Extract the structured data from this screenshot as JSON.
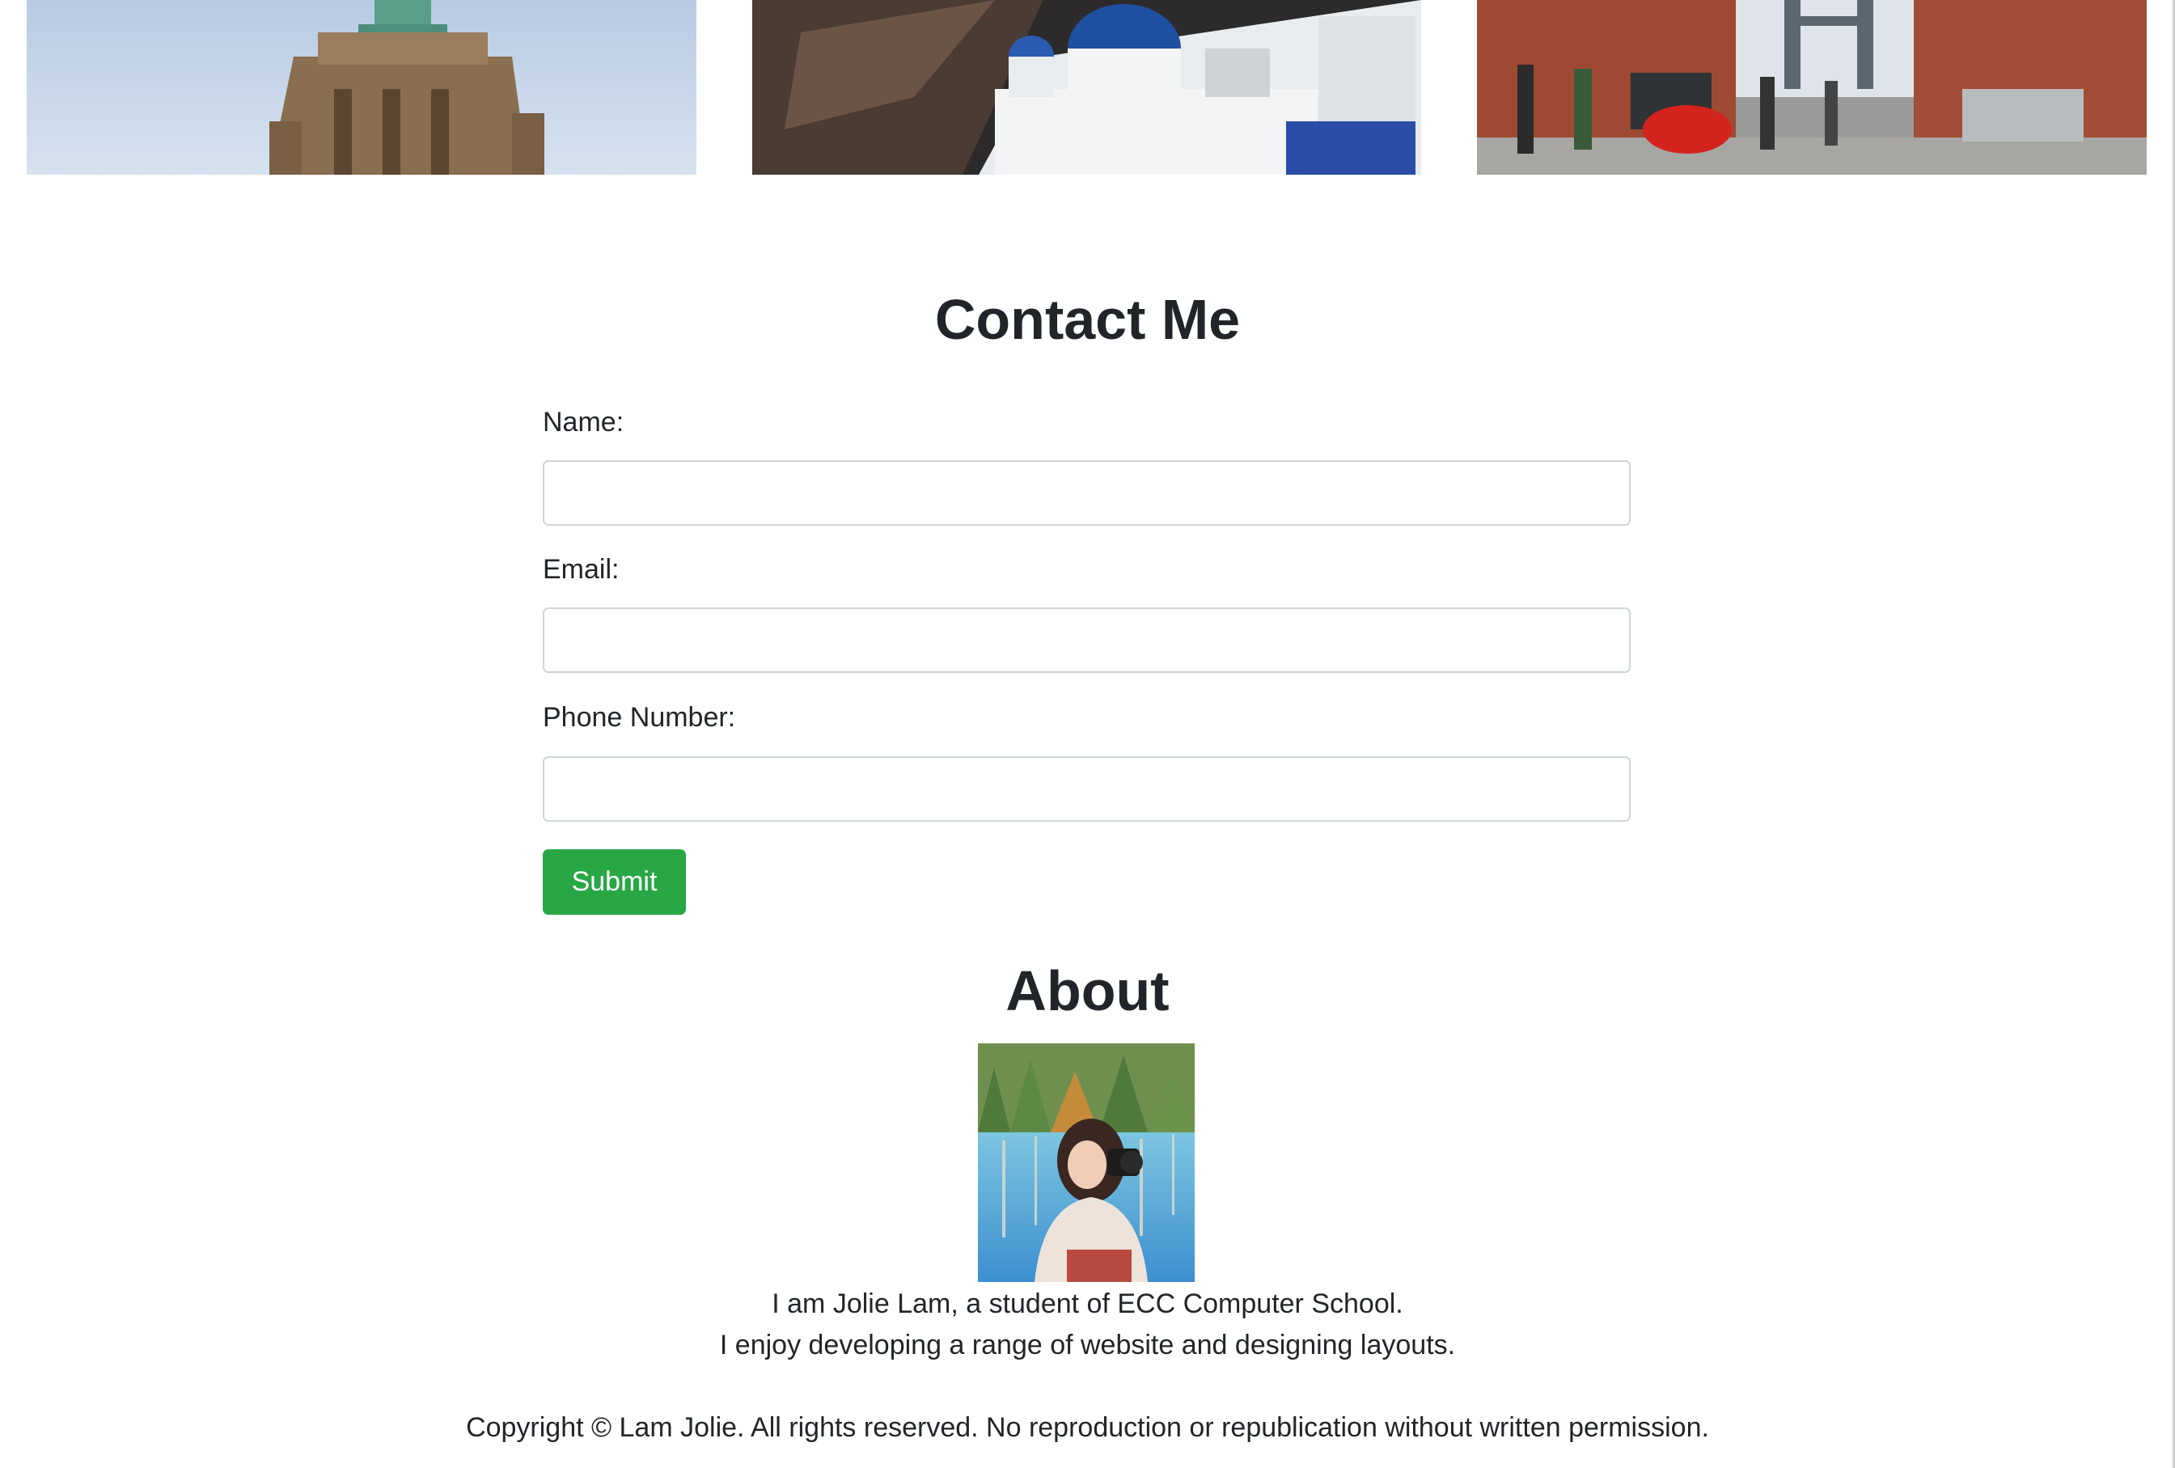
{
  "gallery": {
    "photos": [
      {
        "icon": "statue-of-liberty-photo"
      },
      {
        "icon": "santorini-photo"
      },
      {
        "icon": "brooklyn-street-photo"
      }
    ]
  },
  "contact": {
    "title": "Contact Me",
    "name_label": "Name:",
    "email_label": "Email:",
    "phone_label": "Phone Number:",
    "name_value": "",
    "email_value": "",
    "phone_value": "",
    "submit_label": "Submit"
  },
  "about": {
    "title": "About",
    "portrait_icon": "portrait-photo",
    "line1": "I am Jolie Lam, a student of ECC Computer School.",
    "line2": "I enjoy developing a range of website and designing layouts."
  },
  "footer": {
    "copyright": "Copyright © Lam Jolie. All rights reserved. No reproduction or republication without written permission."
  },
  "colors": {
    "accent": "#28a745",
    "text": "#212529",
    "input_border": "#ced4da"
  }
}
